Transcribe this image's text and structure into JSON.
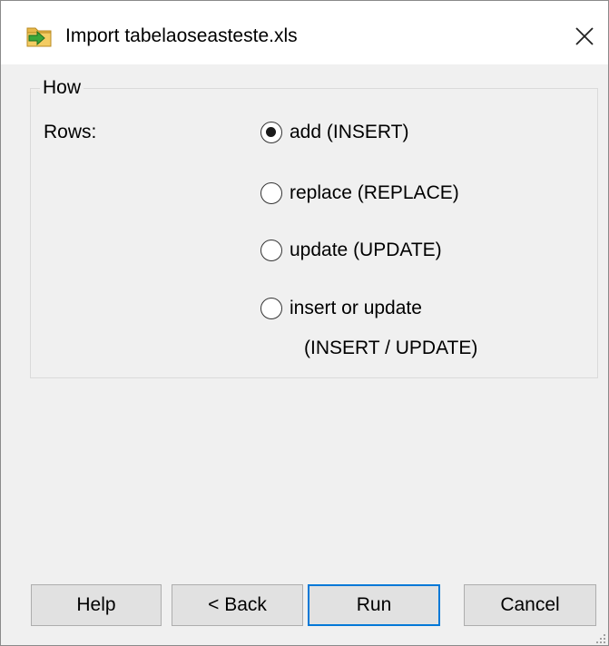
{
  "window": {
    "title": "Import tabelaoseasteste.xls",
    "icon": "import-folder-icon",
    "close_icon": "close-icon"
  },
  "group": {
    "legend": "How",
    "rows_label": "Rows:",
    "options": [
      {
        "label": "add (INSERT)",
        "selected": true
      },
      {
        "label": "replace (REPLACE)",
        "selected": false
      },
      {
        "label": "update (UPDATE)",
        "selected": false
      },
      {
        "label": "insert or update",
        "sublabel": "(INSERT / UPDATE)",
        "selected": false
      }
    ]
  },
  "buttons": {
    "help": "Help",
    "back": "< Back",
    "run": "Run",
    "cancel": "Cancel"
  },
  "colors": {
    "accent": "#0078d7",
    "window_bg": "#f0f0f0",
    "titlebar_bg": "#ffffff",
    "button_bg": "#e1e1e1"
  }
}
